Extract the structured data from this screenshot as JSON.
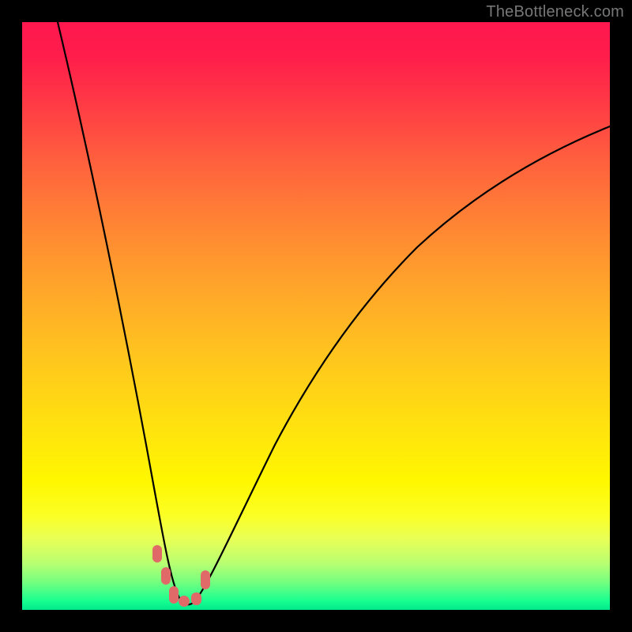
{
  "watermark": "TheBottleneck.com",
  "colors": {
    "background": "#000000",
    "curve": "#000000",
    "markers": "#e06a68"
  },
  "chart_data": {
    "type": "line",
    "title": "",
    "xlabel": "",
    "ylabel": "",
    "xlim": [
      0,
      100
    ],
    "ylim": [
      0,
      100
    ],
    "grid": false,
    "legend": false,
    "series": [
      {
        "name": "bottleneck-curve",
        "x": [
          5,
          10,
          15,
          20,
          22,
          24,
          26,
          28,
          30,
          33,
          38,
          45,
          55,
          65,
          75,
          85,
          95,
          100
        ],
        "values": [
          100,
          72,
          45,
          22,
          12,
          5,
          1,
          0,
          1,
          6,
          18,
          34,
          52,
          64,
          72,
          78,
          82,
          84
        ]
      }
    ],
    "markers": {
      "name": "selected-range",
      "x": [
        22.5,
        24.0,
        25.5,
        27.0,
        28.5,
        30.0
      ],
      "values": [
        10.0,
        4.5,
        1.5,
        0.4,
        0.8,
        4.0
      ]
    }
  }
}
